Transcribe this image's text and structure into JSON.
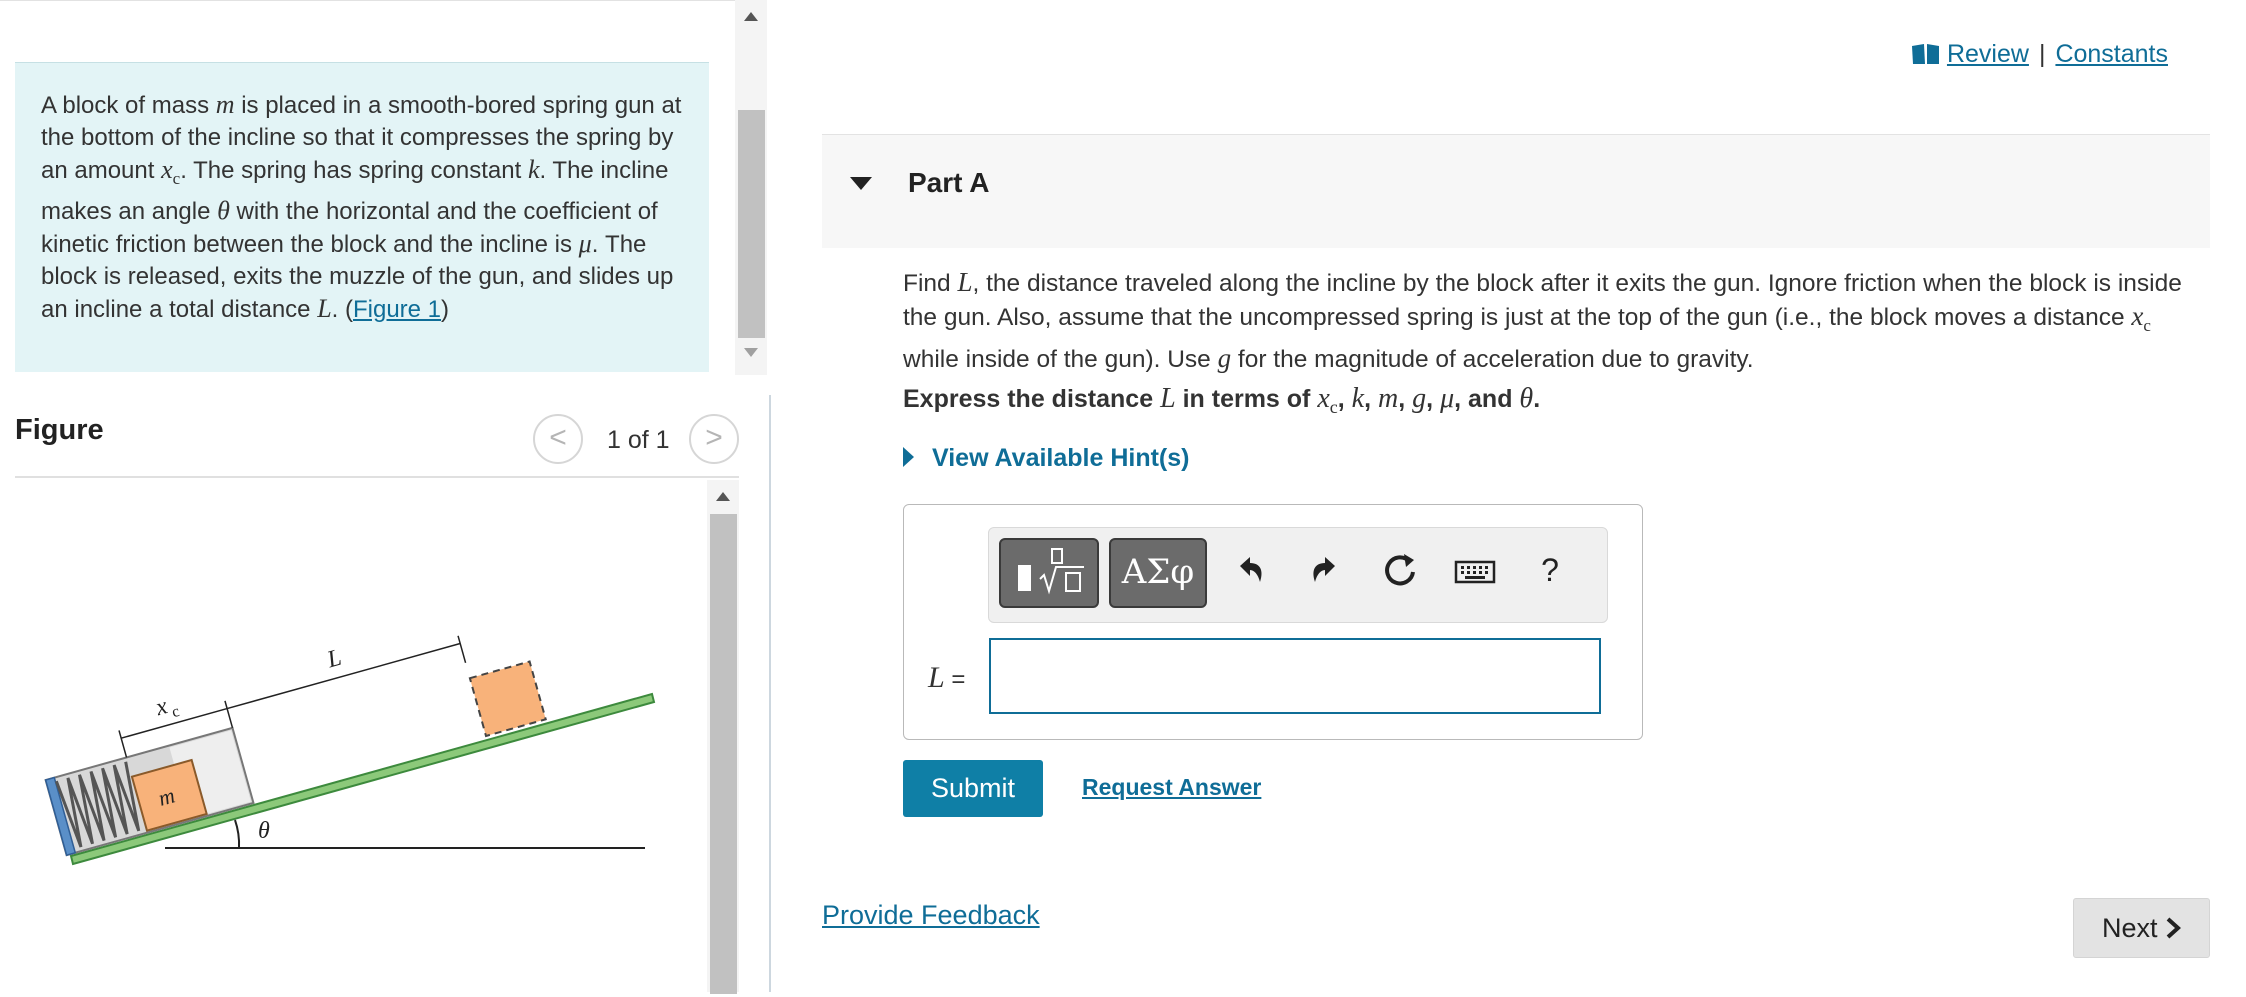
{
  "problem": {
    "p1": "A block of mass ",
    "m": "m",
    "p2": " is placed in a smooth-bored spring gun at the bottom of the incline so that it compresses the spring by an amount ",
    "xc_x": "x",
    "xc_c": "c",
    "p3": ". The spring has spring constant ",
    "k": "k",
    "p4": ". The incline makes an angle ",
    "theta": "θ",
    "p5": " with the horizontal and the coefficient of kinetic friction between the block and the incline is ",
    "mu": "μ",
    "p6": ". The block is released, exits the muzzle of the gun, and slides up an incline a total distance ",
    "L": "L",
    "p7": ". (",
    "figure_link": "Figure 1",
    "p8": ")"
  },
  "figure": {
    "title": "Figure",
    "counter": "1 of 1",
    "prev_glyph": "<",
    "next_glyph": ">",
    "label_xc_x": "x",
    "label_xc_c": "c",
    "label_L": "L",
    "label_m": "m",
    "label_theta": "θ",
    "colors": {
      "block": "#f8b27a",
      "incline": "#8cc97a",
      "gun": "#5a8fc8",
      "spring": "#555555"
    }
  },
  "header": {
    "review": "Review",
    "separator": "|",
    "constants": "Constants"
  },
  "part": {
    "title": "Part A"
  },
  "question": {
    "q1": "Find ",
    "L": "L",
    "q2": ", the distance traveled along the incline by the block after it exits the gun. Ignore friction when the block is inside the gun. Also, assume that the uncompressed spring is just at the top of the gun (i.e., the block moves a distance ",
    "xc_x": "x",
    "xc_c": "c",
    "q3": " while inside of the gun). Use ",
    "g": "g",
    "q4": " for the magnitude of acceleration due to gravity."
  },
  "instruction": {
    "i1": "Express the distance ",
    "L": "L",
    "i2": " in terms of ",
    "xc_x": "x",
    "xc_c": "c",
    "c1": ", ",
    "k": "k",
    "c2": ", ",
    "m": "m",
    "c3": ", ",
    "g": "g",
    "c4": ", ",
    "mu": "μ",
    "c5": ", and ",
    "theta": "θ",
    "end": "."
  },
  "hints": {
    "label": "View Available Hint(s)"
  },
  "toolbar": {
    "greek_label": "ΑΣφ",
    "help": "?"
  },
  "answer": {
    "var": "L",
    "equals": " =",
    "value": ""
  },
  "actions": {
    "submit": "Submit",
    "request_answer": "Request Answer",
    "provide_feedback": "Provide Feedback",
    "next": "Next"
  }
}
